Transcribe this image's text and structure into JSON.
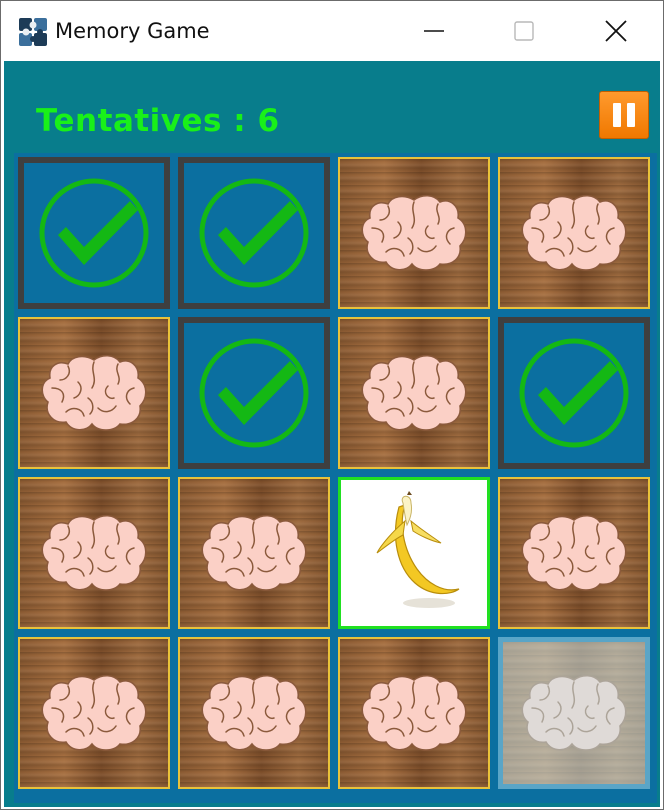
{
  "window": {
    "title": "Memory Game",
    "app_icon": "puzzle-icon"
  },
  "header": {
    "tries_label": "Tentatives : 6",
    "pause_icon": "pause-icon"
  },
  "colors": {
    "background": "#087d8c",
    "board": "#0b6fa0",
    "tries_text": "#19f019",
    "pause_button": "#f07800",
    "check": "#14b814"
  },
  "board": {
    "rows": 4,
    "cols": 4,
    "cards": [
      {
        "state": "matched",
        "icon": "check-icon"
      },
      {
        "state": "matched",
        "icon": "check-icon"
      },
      {
        "state": "hidden",
        "icon": "brain-icon"
      },
      {
        "state": "hidden",
        "icon": "brain-icon"
      },
      {
        "state": "hidden",
        "icon": "brain-icon"
      },
      {
        "state": "matched",
        "icon": "check-icon"
      },
      {
        "state": "hidden",
        "icon": "brain-icon"
      },
      {
        "state": "matched",
        "icon": "check-icon"
      },
      {
        "state": "hidden",
        "icon": "brain-icon"
      },
      {
        "state": "hidden",
        "icon": "brain-icon"
      },
      {
        "state": "revealed",
        "icon": "banana-icon"
      },
      {
        "state": "hidden",
        "icon": "brain-icon"
      },
      {
        "state": "hidden",
        "icon": "brain-icon"
      },
      {
        "state": "hidden",
        "icon": "brain-icon"
      },
      {
        "state": "hidden",
        "icon": "brain-icon"
      },
      {
        "state": "hover",
        "icon": "brain-icon"
      }
    ]
  }
}
